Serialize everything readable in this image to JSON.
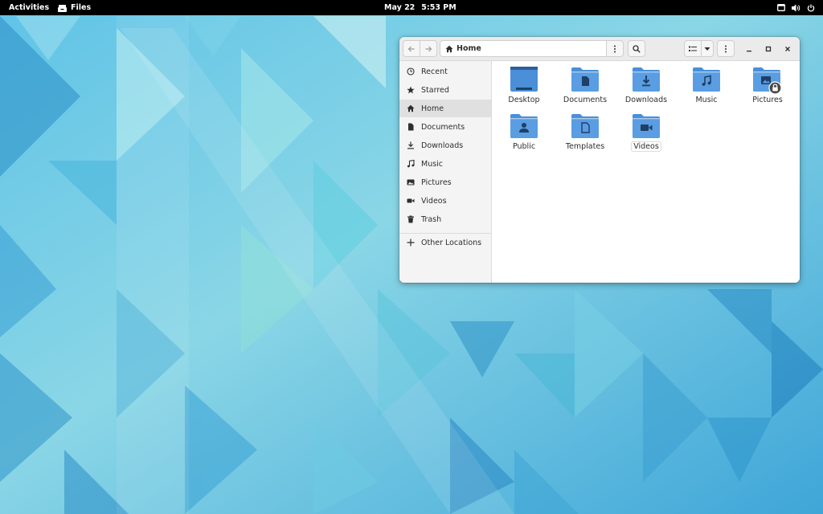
{
  "topbar": {
    "activities": "Activities",
    "app_name": "Files",
    "date": "May 22",
    "time": "5:53 PM"
  },
  "window": {
    "path_label": "Home",
    "path_icon": "home-icon"
  },
  "sidebar": {
    "items": [
      {
        "label": "Recent",
        "icon": "clock-icon"
      },
      {
        "label": "Starred",
        "icon": "star-icon"
      },
      {
        "label": "Home",
        "icon": "home-icon",
        "active": true
      },
      {
        "label": "Documents",
        "icon": "document-icon"
      },
      {
        "label": "Downloads",
        "icon": "download-icon"
      },
      {
        "label": "Music",
        "icon": "music-icon"
      },
      {
        "label": "Pictures",
        "icon": "picture-icon"
      },
      {
        "label": "Videos",
        "icon": "video-icon"
      },
      {
        "label": "Trash",
        "icon": "trash-icon"
      }
    ],
    "other_locations": "Other Locations"
  },
  "files": [
    {
      "label": "Desktop",
      "icon": "desktop-folder-icon"
    },
    {
      "label": "Documents",
      "icon": "documents-folder-icon"
    },
    {
      "label": "Downloads",
      "icon": "downloads-folder-icon"
    },
    {
      "label": "Music",
      "icon": "music-folder-icon"
    },
    {
      "label": "Pictures",
      "icon": "pictures-folder-icon",
      "locked": true
    },
    {
      "label": "Public",
      "icon": "public-folder-icon"
    },
    {
      "label": "Templates",
      "icon": "templates-folder-icon"
    },
    {
      "label": "Videos",
      "icon": "videos-folder-icon"
    }
  ],
  "colors": {
    "folder": "#4a8fd8",
    "folder_dark": "#2f6fb9",
    "topbar": "#000000",
    "sidebar_active": "#e0e0e0"
  }
}
